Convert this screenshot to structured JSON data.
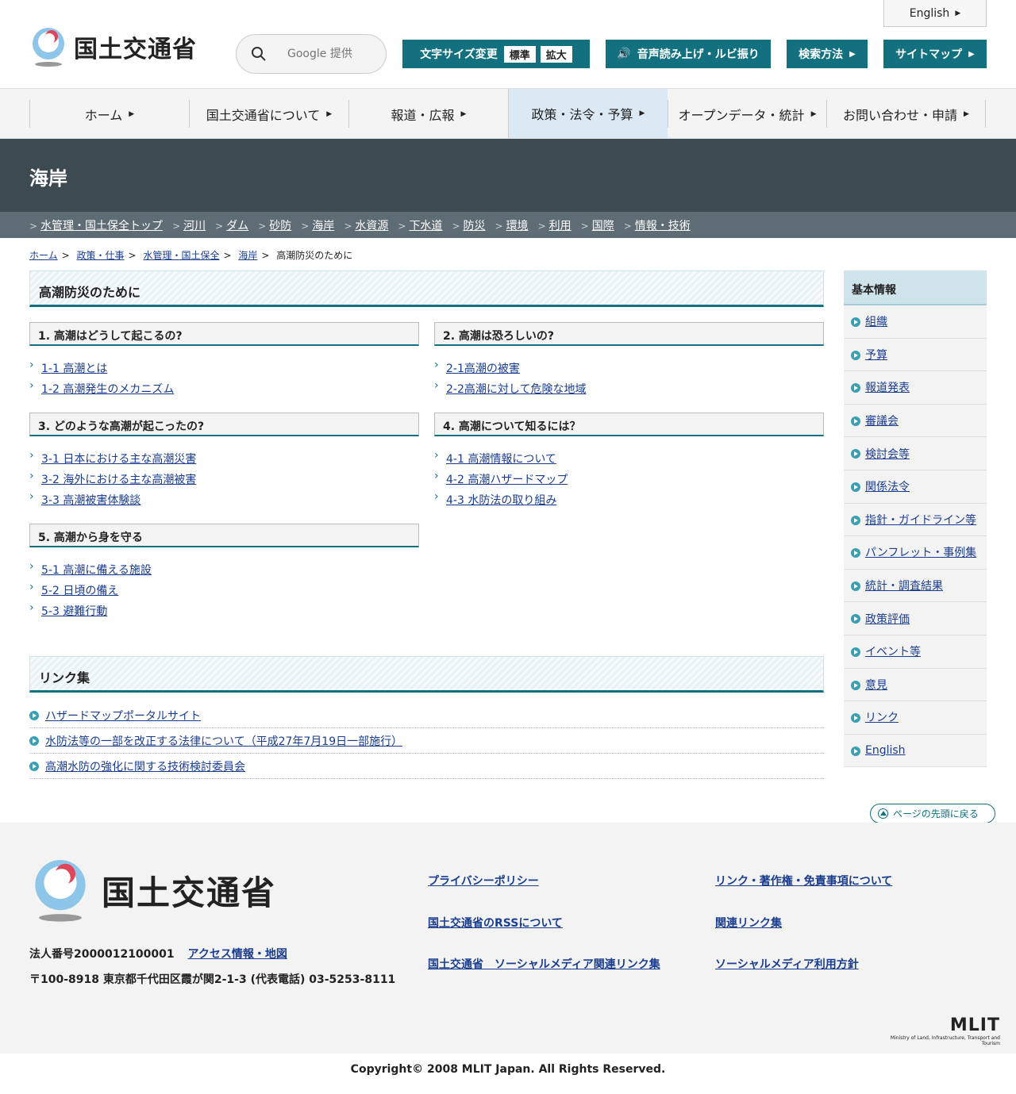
{
  "header": {
    "logo_text": "国土交通省",
    "english_label": "English",
    "search_placeholder": "Google 提供",
    "font_size_label": "文字サイズ変更",
    "font_size_normal": "標準",
    "font_size_large": "拡大",
    "voice_label": "音声読み上げ・ルビ振り",
    "search_method_label": "検索方法",
    "sitemap_label": "サイトマップ"
  },
  "gnav": [
    {
      "label": "ホーム"
    },
    {
      "label": "国土交通省について"
    },
    {
      "label": "報道・広報"
    },
    {
      "label": "政策・法令・予算"
    },
    {
      "label": "オープンデータ・統計"
    },
    {
      "label": "お問い合わせ・申請"
    }
  ],
  "page": {
    "title": "海岸"
  },
  "subnav": [
    "水管理・国土保全トップ",
    "河川",
    "ダム",
    "砂防",
    "海岸",
    "水資源",
    "下水道",
    "防災",
    "環境",
    "利用",
    "国際",
    "情報・技術"
  ],
  "breadcrumb": {
    "items": [
      "ホーム",
      "政策・仕事",
      "水管理・国土保全",
      "海岸"
    ],
    "current": "高潮防災のために",
    "separator": ">"
  },
  "main": {
    "heading": "高潮防災のために",
    "sections": [
      {
        "title": "1. 高潮はどうして起こるの?",
        "links": [
          "1-1 高潮とは",
          "1-2 高潮発生のメカニズム"
        ]
      },
      {
        "title": "2. 高潮は恐ろしいの?",
        "links": [
          "2-1高潮の被害",
          "2-2高潮に対して危険な地域"
        ]
      },
      {
        "title": "3. どのような高潮が起こったの?",
        "links": [
          "3-1 日本における主な高潮災害",
          "3-2 海外における主な高潮被害",
          "3-3 高潮被害体験談"
        ]
      },
      {
        "title": "4. 高潮について知るには？",
        "links": [
          "4-1 高潮情報について",
          "4-2 高潮ハザードマップ",
          "4-3 水防法の取り組み"
        ]
      },
      {
        "title": "5. 高潮から身を守る",
        "links": [
          "5-1 高潮に備える施設",
          "5-2 日頃の備え",
          "5-3 避難行動"
        ]
      }
    ],
    "links_heading": "リンク集",
    "links": [
      "ハザードマップポータルサイト",
      "水防法等の一部を改正する法律について（平成27年7月19日一部施行）",
      "高潮水防の強化に関する技術検討委員会"
    ]
  },
  "side": {
    "heading": "基本情報",
    "items": [
      "組織",
      "予算",
      "報道発表",
      "審議会",
      "検討会等",
      "関係法令",
      "指針・ガイドライン等",
      "パンフレット・事例集",
      "統計・調査結果",
      "政策評価",
      "イベント等",
      "意見",
      "リンク",
      "English"
    ]
  },
  "pagetop_label": "ページの先頭に戻る",
  "footer": {
    "logo_text": "国土交通省",
    "corp_number": "法人番号2000012100001",
    "access_label": "アクセス情報・地図",
    "address": "〒100-8918 東京都千代田区霞が関2-1-3 (代表電話) 03-5253-8111",
    "links": [
      "プライバシーポリシー",
      "リンク・著作権・免責事項について",
      "国土交通省のRSSについて",
      "関連リンク集",
      "国土交通省　ソーシャルメディア関連リンク集",
      "ソーシャルメディア利用方針"
    ],
    "mlit_logo": "MLIT",
    "mlit_subtitle": "Ministry of Land, Infrastructure, Transport and Tourism",
    "copyright": "Copyright© 2008 MLIT Japan. All Rights Reserved."
  },
  "colors": {
    "accent": "#12707f",
    "title_band": "#3d4a52",
    "subnav": "#5e6c75",
    "link": "#1a3d8f"
  }
}
